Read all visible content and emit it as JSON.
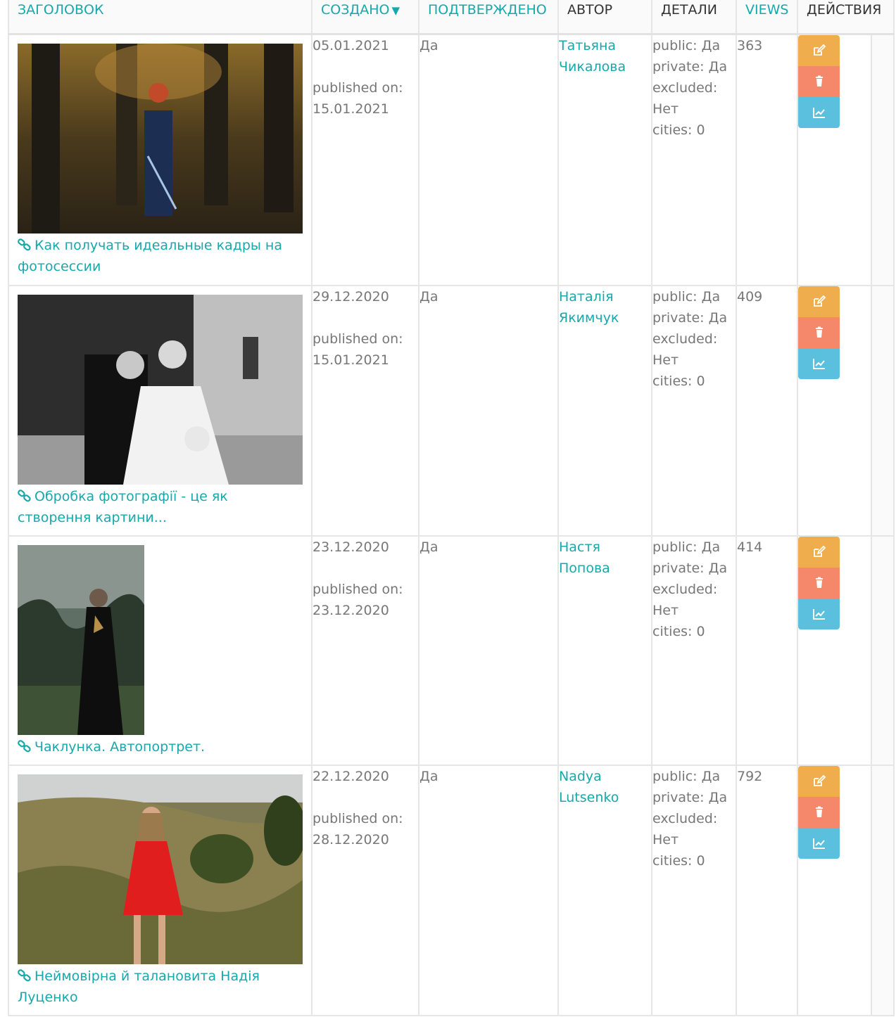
{
  "headers": {
    "title": "Заголовок",
    "created": "Создано",
    "sort_arrow": "▼",
    "confirmed": "Подтверждено",
    "author": "Автор",
    "details": "Детали",
    "views": "Views",
    "actions": "Действия"
  },
  "colors": {
    "accent": "#17a8ac",
    "edit_button": "#f0ad4e",
    "delete_button": "#f5886a",
    "stats_button": "#5bc0de"
  },
  "icons": {
    "title_link": "link-icon",
    "edit": "edit-icon",
    "delete": "trash-icon",
    "stats": "line-chart-icon"
  },
  "rows": [
    {
      "title": "Как получать идеальные кадры на фотосессии",
      "created": "05.01.2021",
      "published_label": "published on:",
      "published_date": "15.01.2021",
      "confirmed": "Да",
      "author": "Татьяна Чикалова",
      "details": {
        "public": "public: Да",
        "private": "private: Да",
        "excluded": "excluded: Нет",
        "cities": "cities: 0"
      },
      "views": "363"
    },
    {
      "title": "Обробка фотографії - це як створення картини...",
      "created": "29.12.2020",
      "published_label": "published on:",
      "published_date": "15.01.2021",
      "confirmed": "Да",
      "author": "Наталія Якимчук",
      "details": {
        "public": "public: Да",
        "private": "private: Да",
        "excluded": "excluded: Нет",
        "cities": "cities: 0"
      },
      "views": "409"
    },
    {
      "title": "Чаклунка. Автопортрет.",
      "created": "23.12.2020",
      "published_label": "published on:",
      "published_date": "23.12.2020",
      "confirmed": "Да",
      "author": "Настя Попова",
      "details": {
        "public": "public: Да",
        "private": "private: Да",
        "excluded": "excluded: Нет",
        "cities": "cities: 0"
      },
      "views": "414"
    },
    {
      "title": "Неймовірна й талановита Надія Луценко",
      "created": "22.12.2020",
      "published_label": "published on:",
      "published_date": "28.12.2020",
      "confirmed": "Да",
      "author": "Nadya Lutsenko",
      "details": {
        "public": "public: Да",
        "private": "private: Да",
        "excluded": "excluded: Нет",
        "cities": "cities: 0"
      },
      "views": "792"
    }
  ]
}
